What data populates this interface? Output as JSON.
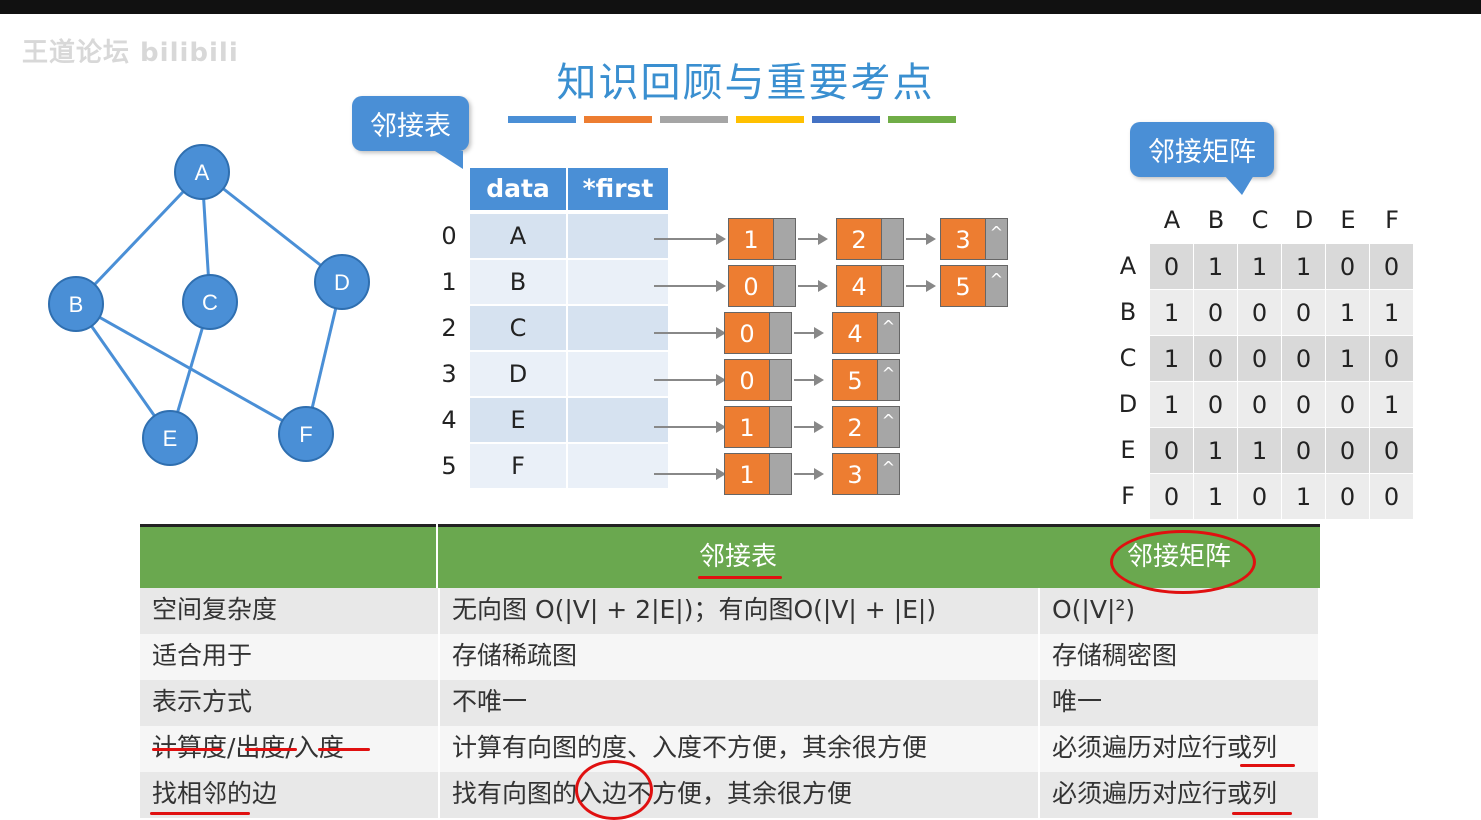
{
  "watermark": "王道论坛 bilibili",
  "title": "知识回顾与重要考点",
  "colors": {
    "accent_blue": "#4a8fd6",
    "title_blue": "#3a8fd0",
    "header_green": "#6aa84f",
    "node_orange": "#ed7d31",
    "pointer_gray": "#a6a6a6",
    "annotation_red": "#e01010",
    "bar_colors": [
      "#4a8fd6",
      "#ed7d31",
      "#a5a5a5",
      "#ffc000",
      "#4472c4",
      "#70ad47"
    ]
  },
  "callouts": {
    "adj_list": "邻接表",
    "adj_matrix": "邻接矩阵"
  },
  "graph": {
    "vertices": [
      "A",
      "B",
      "C",
      "D",
      "E",
      "F"
    ],
    "edges": [
      [
        "A",
        "B"
      ],
      [
        "A",
        "C"
      ],
      [
        "A",
        "D"
      ],
      [
        "B",
        "E"
      ],
      [
        "B",
        "F"
      ],
      [
        "C",
        "E"
      ],
      [
        "D",
        "F"
      ]
    ]
  },
  "adj_list": {
    "headers": [
      "data",
      "*first"
    ],
    "rows": [
      {
        "index": "0",
        "data": "A",
        "chain": [
          "1",
          "2",
          "3"
        ]
      },
      {
        "index": "1",
        "data": "B",
        "chain": [
          "0",
          "4",
          "5"
        ]
      },
      {
        "index": "2",
        "data": "C",
        "chain": [
          "0",
          "4"
        ]
      },
      {
        "index": "3",
        "data": "D",
        "chain": [
          "0",
          "5"
        ]
      },
      {
        "index": "4",
        "data": "E",
        "chain": [
          "1",
          "2"
        ]
      },
      {
        "index": "5",
        "data": "F",
        "chain": [
          "1",
          "3"
        ]
      }
    ],
    "null_symbol": "^"
  },
  "adj_matrix": {
    "labels": [
      "A",
      "B",
      "C",
      "D",
      "E",
      "F"
    ],
    "rows": [
      [
        "0",
        "1",
        "1",
        "1",
        "0",
        "0"
      ],
      [
        "1",
        "0",
        "0",
        "0",
        "1",
        "1"
      ],
      [
        "1",
        "0",
        "0",
        "0",
        "1",
        "0"
      ],
      [
        "1",
        "0",
        "0",
        "0",
        "0",
        "1"
      ],
      [
        "0",
        "1",
        "1",
        "0",
        "0",
        "0"
      ],
      [
        "0",
        "1",
        "0",
        "1",
        "0",
        "0"
      ]
    ]
  },
  "comparison": {
    "headers": [
      "",
      "邻接表",
      "邻接矩阵"
    ],
    "rows": [
      {
        "label": "空间复杂度",
        "list": "无向图 O(|V| + 2|E|)；有向图O(|V| + |E|)",
        "matrix": "O(|V|²)"
      },
      {
        "label": "适合用于",
        "list": "存储稀疏图",
        "matrix": "存储稠密图"
      },
      {
        "label": "表示方式",
        "list": "不唯一",
        "matrix": "唯一"
      },
      {
        "label": "计算度/出度/入度",
        "list": "计算有向图的度、入度不方便，其余很方便",
        "matrix": "必须遍历对应行或列"
      },
      {
        "label": "找相邻的边",
        "list": "找有向图的入边不方便，其余很方便",
        "matrix": "必须遍历对应行或列"
      }
    ]
  }
}
